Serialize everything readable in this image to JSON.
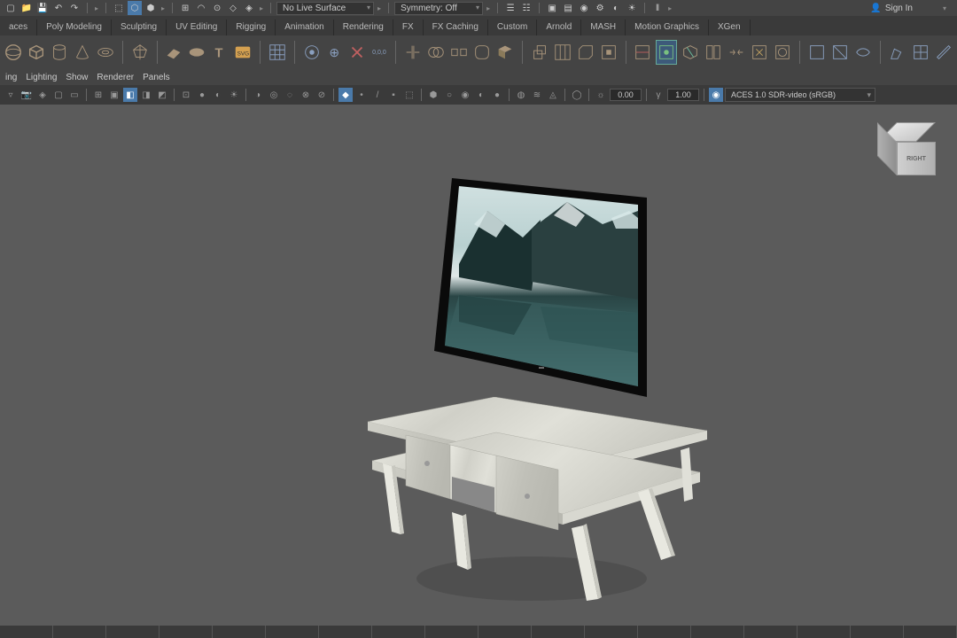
{
  "top": {
    "live_surface": "No Live Surface",
    "symmetry": "Symmetry: Off",
    "signin": "Sign In"
  },
  "tabs": [
    "aces",
    "Poly Modeling",
    "Sculpting",
    "UV Editing",
    "Rigging",
    "Animation",
    "Rendering",
    "FX",
    "FX Caching",
    "Custom",
    "Arnold",
    "MASH",
    "Motion Graphics",
    "XGen"
  ],
  "panel_menu": [
    "ing",
    "Lighting",
    "Show",
    "Renderer",
    "Panels"
  ],
  "toolbar": {
    "exposure": "0.00",
    "gamma": "1.00",
    "color_profile": "ACES 1.0 SDR-video (sRGB)"
  },
  "viewcube": {
    "face": "RIGHT"
  }
}
